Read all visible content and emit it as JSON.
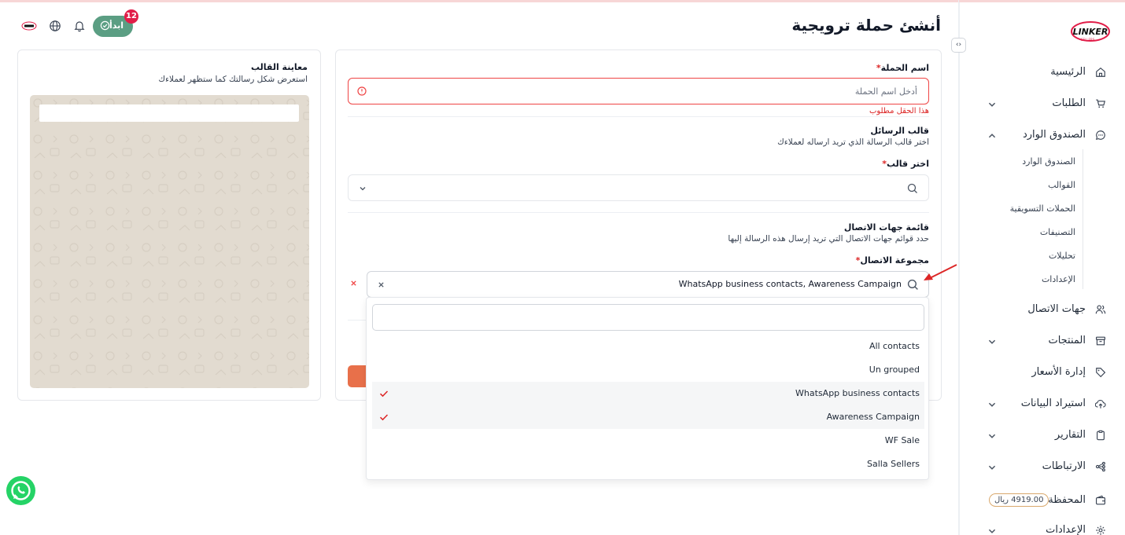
{
  "page": {
    "title": "أنشئ حملة ترويجية"
  },
  "header": {
    "start_label": "ابدأ",
    "notifications_count": "12"
  },
  "logo": {
    "text": "LINKER",
    "subtext": "SELLERS"
  },
  "sidebar": {
    "items": [
      {
        "label": "الرئيسية",
        "icon": "home-icon"
      },
      {
        "label": "الطلبات",
        "icon": "cart-icon",
        "has_chevron": true
      },
      {
        "label": "الصندوق الوارد",
        "icon": "chat-icon",
        "expanded": true
      },
      {
        "label": "جهات الاتصال",
        "icon": "users-icon"
      },
      {
        "label": "المنتجات",
        "icon": "box-icon",
        "has_chevron": true
      },
      {
        "label": "إدارة الأسعار",
        "icon": "tag-icon"
      },
      {
        "label": "استيراد البيانات",
        "icon": "upload-icon",
        "has_chevron": true
      },
      {
        "label": "التقارير",
        "icon": "clipboard-icon",
        "has_chevron": true
      },
      {
        "label": "الارتباطات",
        "icon": "share-icon",
        "has_chevron": true
      },
      {
        "label": "المحفظة",
        "icon": "wallet-icon",
        "badge": "4919.00 ريال"
      },
      {
        "label": "الإعدادات",
        "icon": "gear-icon",
        "has_chevron": true
      }
    ],
    "inbox_sub": [
      "الصندوق الوارد",
      "القوالب",
      "الحملات التسويقية",
      "التصنيفات",
      "تحليلات",
      "الإعدادات"
    ]
  },
  "form": {
    "campaign_name_label": "اسم الحملة",
    "required_mark": "*",
    "campaign_name_placeholder": "أدخل اسم الحملة",
    "campaign_name_error": "هذا الحقل مطلوب",
    "template_section_title": "قالب الرسائل",
    "template_section_sub": "اختر قالب الرسالة الذي تريد ارساله لعملاءك",
    "template_select_label": "اختر قالب",
    "contacts_section_title": "قائمة جهات الاتصال",
    "contacts_section_sub": "حدد قوائم جهات الاتصال التي تريد إرسال هذه الرسالة إليها",
    "contact_group_label": "مجموعة الاتصال",
    "contact_group_value": "WhatsApp business contacts, Awareness Campaign"
  },
  "dropdown": {
    "search_value": "",
    "options": [
      {
        "label": "All contacts",
        "selected": false
      },
      {
        "label": "Un grouped",
        "selected": false
      },
      {
        "label": "WhatsApp business contacts",
        "selected": true
      },
      {
        "label": "Awareness Campaign",
        "selected": true
      },
      {
        "label": "WF Sale",
        "selected": false
      },
      {
        "label": "Salla Sellers",
        "selected": false
      }
    ]
  },
  "preview": {
    "title": "معاينة القالب",
    "subtitle": "استعرض شكل رسالتك كما ستظهر لعملاءك"
  },
  "colors": {
    "accent_green": "#5b9e83",
    "error_red": "#ef4444",
    "submit_orange": "#e8704a",
    "check_red": "#dc2626"
  }
}
